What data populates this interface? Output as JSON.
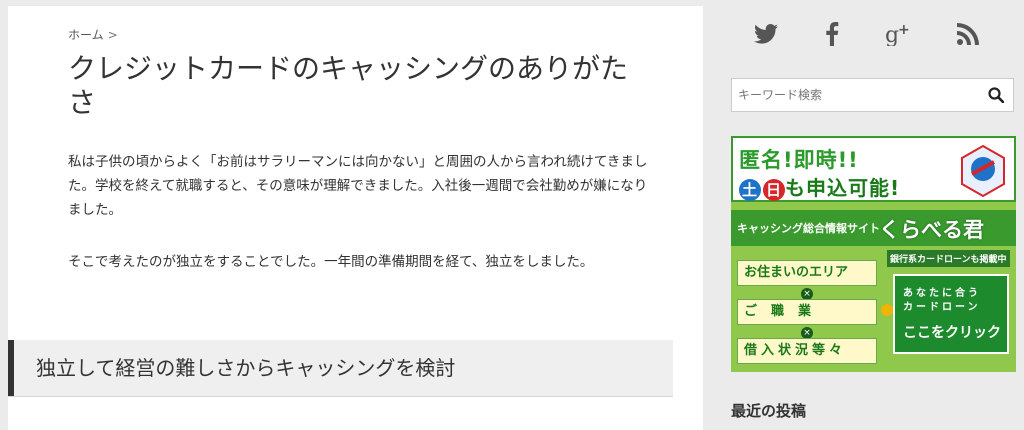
{
  "breadcrumb": {
    "home": "ホーム",
    "separator": ">"
  },
  "article": {
    "title": "クレジットカードのキャッシングのありがたさ",
    "paragraph1": "私は子供の頃からよく「お前はサラリーマンには向かない」と周囲の人から言われ続けてきました。学校を終えて就職すると、その意味が理解できました。入社後一週間で会社勤めが嫌になりました。",
    "paragraph2": "そこで考えたのが独立をすることでした。一年間の準備期間を経て、独立をしました。",
    "heading2": "独立して経営の難しさからキャッシングを検討"
  },
  "sidebar": {
    "social": [
      {
        "icon": "twitter-icon"
      },
      {
        "icon": "facebook-icon"
      },
      {
        "icon": "google-plus-icon"
      },
      {
        "icon": "rss-icon"
      }
    ],
    "search": {
      "placeholder": "キーワード検索"
    },
    "ad": {
      "line1": "匿名!即時!!",
      "day1": "土",
      "day2": "日",
      "line2_rest": "も申込可能!",
      "site_label": "キャッシング総合情報サイト",
      "brand": "くらべる君",
      "note": "銀行系カードローンも掲載中",
      "box1": "お住まいのエリア",
      "box2": "ご職業",
      "box3": "借入状況等々",
      "cta_line1": "あなたに合う",
      "cta_line2": "カードローン",
      "cta_line3": "ここをクリック"
    },
    "recent_posts_title": "最近の投稿"
  },
  "colors": {
    "ad_green": "#3a9a2e",
    "heading_bar": "#333333",
    "page_bg": "#ebebeb"
  }
}
